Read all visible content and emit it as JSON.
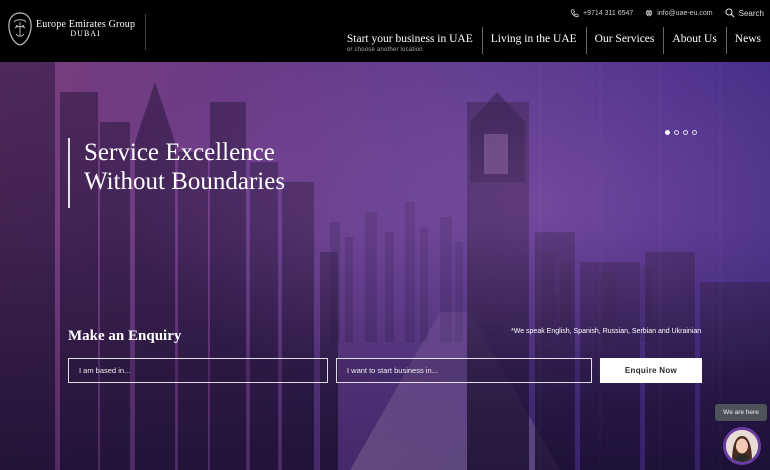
{
  "brand": {
    "line1": "Europe Emirates Group",
    "line2": "DUBAI"
  },
  "utility": {
    "phone": "+9714 311 6547",
    "email": "info@uae-eu.com",
    "search_label": "Search"
  },
  "nav": [
    {
      "label": "Start your business in UAE",
      "sub": "or choose another location"
    },
    {
      "label": "Living in the UAE",
      "sub": ""
    },
    {
      "label": "Our Services",
      "sub": ""
    },
    {
      "label": "About Us",
      "sub": ""
    },
    {
      "label": "News",
      "sub": ""
    }
  ],
  "hero": {
    "headline_line1": "Service Excellence",
    "headline_line2": "Without Boundaries",
    "slides_total": 4,
    "slide_active": 1
  },
  "enquiry": {
    "title": "Make an Enquiry",
    "languages": "*We speak English, Spanish, Russian, Serbian and Ukrainian",
    "based_placeholder": "I am based in...",
    "start_placeholder": "I want to start business in...",
    "button": "Enquire Now"
  },
  "chat": {
    "label": "We are here"
  },
  "colors": {
    "header_bg": "#000000",
    "hero_overlay": "#6a3a86",
    "chat_ring": "#6a3ba0"
  }
}
